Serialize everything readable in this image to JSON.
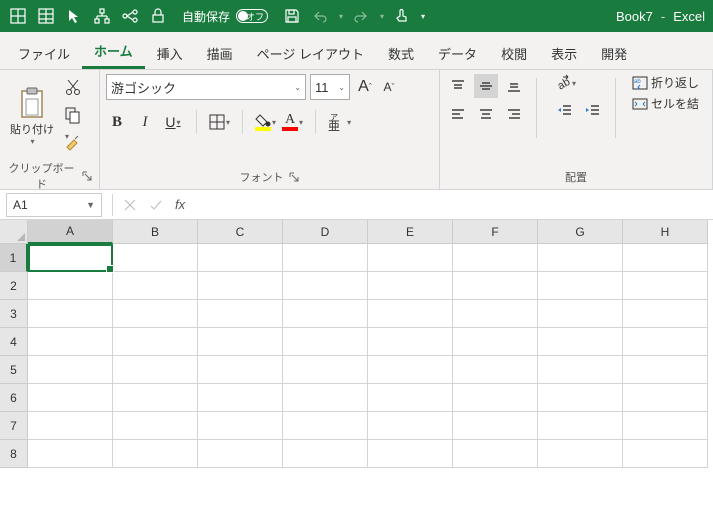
{
  "titlebar": {
    "autosave_label": "自動保存",
    "autosave_state": "オフ",
    "book": "Book7",
    "app": "Excel"
  },
  "menu": {
    "file": "ファイル",
    "home": "ホーム",
    "insert": "挿入",
    "draw": "描画",
    "pagelayout": "ページ レイアウト",
    "formulas": "数式",
    "data": "データ",
    "review": "校閲",
    "view": "表示",
    "dev": "開発"
  },
  "ribbon": {
    "clipboard_label": "クリップボード",
    "paste_label": "貼り付け",
    "font_label": "フォント",
    "font_name": "游ゴシック",
    "font_size": "11",
    "bold": "B",
    "italic": "I",
    "underline": "U",
    "phonetic_top": "ア",
    "phonetic_bottom": "亜",
    "align_label": "配置",
    "wrap": "折り返し",
    "merge": "セルを結"
  },
  "formula_bar": {
    "cell_ref": "A1",
    "fx": "fx"
  },
  "columns": [
    "A",
    "B",
    "C",
    "D",
    "E",
    "F",
    "G",
    "H"
  ],
  "rows": [
    "1",
    "2",
    "3",
    "4",
    "5",
    "6",
    "7",
    "8"
  ]
}
